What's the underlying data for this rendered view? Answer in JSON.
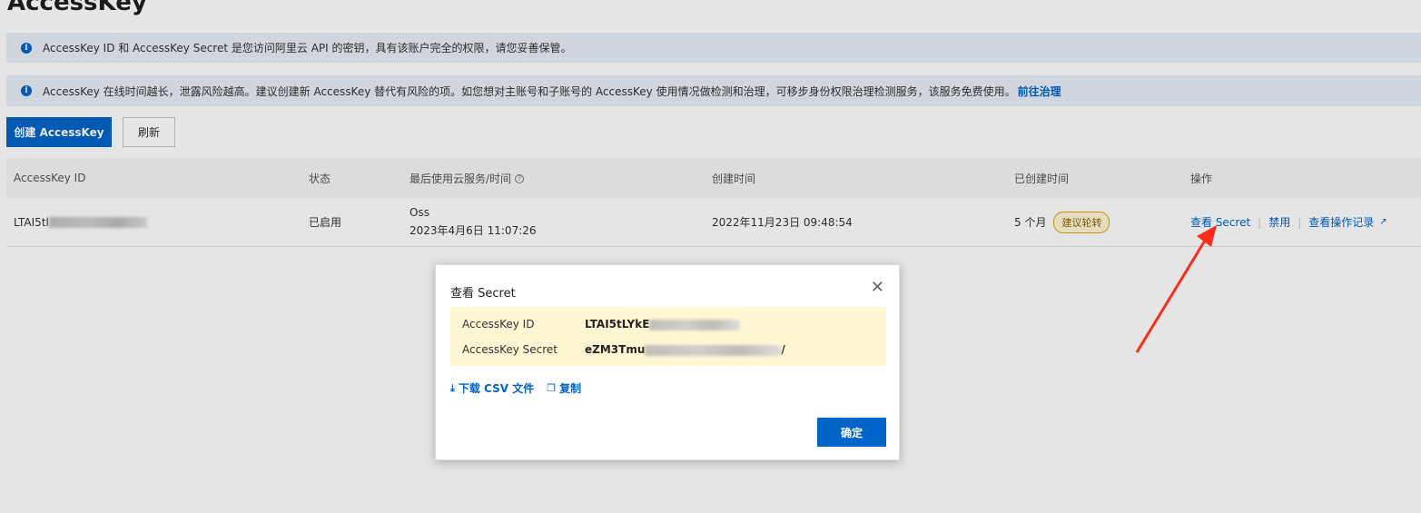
{
  "page": {
    "title": "AccessKey"
  },
  "notices": [
    {
      "text": "AccessKey ID 和 AccessKey Secret 是您访问阿里云 API 的密钥，具有该账户完全的权限，请您妥善保管。"
    },
    {
      "text": "AccessKey 在线时间越长，泄露风险越高。建议创建新 AccessKey 替代有风险的项。如您想对主账号和子账号的 AccessKey 使用情况做检测和治理，可移步身份权限治理检测服务，该服务免费使用。",
      "link": "前往治理"
    }
  ],
  "toolbar": {
    "create_label": "创建 AccessKey",
    "refresh_label": "刷新"
  },
  "table": {
    "headers": [
      "AccessKey ID",
      "状态",
      "最后使用云服务/时间",
      "创建时间",
      "已创建时间",
      "操作"
    ],
    "rows": [
      {
        "id_visible": "LTAI5tl",
        "status": "已启用",
        "last_service": "Oss",
        "last_time": "2023年4月6日 11:07:26",
        "created": "2022年11月23日 09:48:54",
        "age": "5 个月",
        "badge": "建议轮转",
        "actions": [
          "查看 Secret",
          "禁用",
          "查看操作记录"
        ]
      }
    ]
  },
  "modal": {
    "title": "查看 Secret",
    "id_label": "AccessKey ID",
    "id_value_visible": "LTAI5tLYkE",
    "secret_label": "AccessKey Secret",
    "secret_value_visible": "eZM3Tmu",
    "secret_value_tail": "/",
    "download_label": "下载 CSV 文件",
    "copy_label": "复制",
    "ok_label": "确定"
  },
  "colors": {
    "primary": "#0064c8",
    "annotation_arrow": "#ff2a1a"
  }
}
